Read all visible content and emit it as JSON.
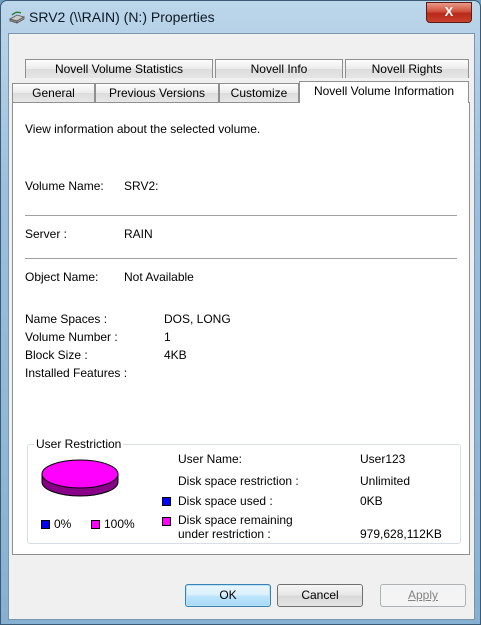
{
  "window": {
    "title": "SRV2 (\\\\RAIN) (N:) Properties",
    "close_label": "X",
    "app_icon": "drive-icon"
  },
  "tabs_row1": [
    {
      "label": "Novell Volume Statistics"
    },
    {
      "label": "Novell Info"
    },
    {
      "label": "Novell Rights"
    }
  ],
  "tabs_row2": [
    {
      "label": "General"
    },
    {
      "label": "Previous Versions"
    },
    {
      "label": "Customize"
    },
    {
      "label": "Novell Volume Information",
      "active": true
    }
  ],
  "panel": {
    "description": "View information about the selected volume.",
    "volume_name_label": "Volume Name:",
    "volume_name_value": "SRV2:",
    "server_label": "Server :",
    "server_value": "RAIN",
    "object_name_label": "Object Name:",
    "object_name_value": "Not Available",
    "name_spaces_label": "Name Spaces :",
    "name_spaces_value": "DOS, LONG",
    "volume_number_label": "Volume Number :",
    "volume_number_value": "1",
    "block_size_label": "Block Size :",
    "block_size_value": "4KB",
    "installed_features_label": "Installed Features :"
  },
  "user_restriction": {
    "legend": "User Restriction",
    "user_name_label": "User Name:",
    "user_name_value": "User123",
    "restriction_label": "Disk space restriction :",
    "restriction_value": "Unlimited",
    "used_label": "Disk space used :",
    "used_value": "0KB",
    "remaining_label_1": "Disk space remaining",
    "remaining_label_2": "under restriction :",
    "remaining_value": "979,628,112KB",
    "used_percent": "0%",
    "remaining_percent": "100%",
    "used_color": "#0000ff",
    "remaining_color": "#ff00ff"
  },
  "buttons": {
    "ok": "OK",
    "cancel": "Cancel",
    "apply": "Apply"
  }
}
